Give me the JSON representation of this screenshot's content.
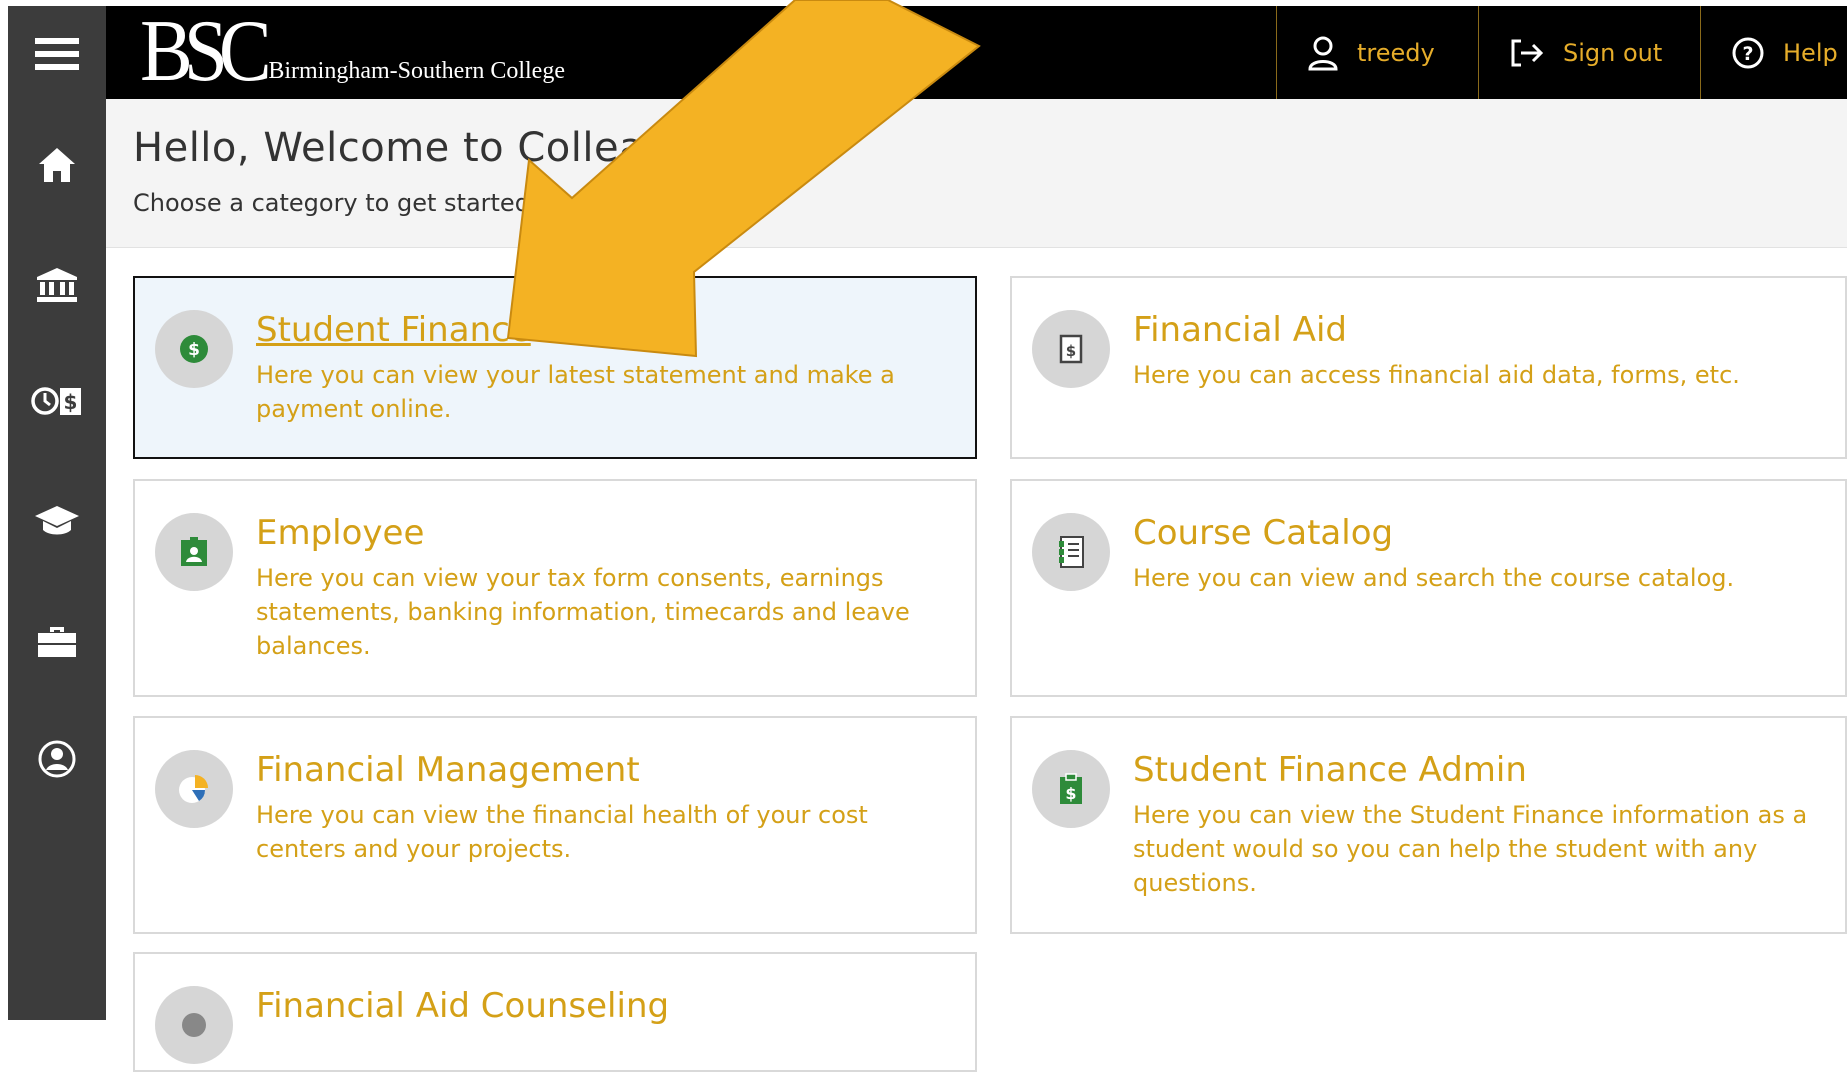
{
  "header": {
    "logo_letters": "BSC",
    "college_name": "Birmingham-Southern College",
    "user_label": "treedy",
    "signout_label": "Sign out",
    "help_label": "Help"
  },
  "sidebar": {
    "items": [
      {
        "icon": "menu-icon"
      },
      {
        "icon": "home-icon"
      },
      {
        "icon": "bank-icon"
      },
      {
        "icon": "clock-dollar-icon"
      },
      {
        "icon": "graduation-cap-icon"
      },
      {
        "icon": "briefcase-icon"
      },
      {
        "icon": "user-circle-icon"
      }
    ]
  },
  "welcome": {
    "title": "Hello, Welcome to Colleagu",
    "subtitle": "Choose a category to get started."
  },
  "cards": [
    {
      "title": "Student Finance",
      "desc": "Here you can view your latest statement and make a payment online.",
      "icon": "dollar-coin-icon"
    },
    {
      "title": "Financial Aid",
      "desc": "Here you can access financial aid data, forms, etc.",
      "icon": "dollar-document-icon"
    },
    {
      "title": "Employee",
      "desc": "Here you can view your tax form consents, earnings statements, banking information, timecards and leave balances.",
      "icon": "id-badge-icon"
    },
    {
      "title": "Course Catalog",
      "desc": "Here you can view and search the course catalog.",
      "icon": "catalog-book-icon"
    },
    {
      "title": "Financial Management",
      "desc": "Here you can view the financial health of your cost centers and your projects.",
      "icon": "pie-chart-icon"
    },
    {
      "title": "Student Finance Admin",
      "desc": "Here you can view the Student Finance information as a student would so you can help the student with any questions.",
      "icon": "clipboard-dollar-icon"
    },
    {
      "title": "Financial Aid Counseling",
      "desc": "",
      "icon": "counseling-icon"
    }
  ],
  "colors": {
    "accent": "#d4a017",
    "header_bg": "#000000",
    "sidebar_bg": "#3c3c3c",
    "arrow": "#f4b223"
  }
}
